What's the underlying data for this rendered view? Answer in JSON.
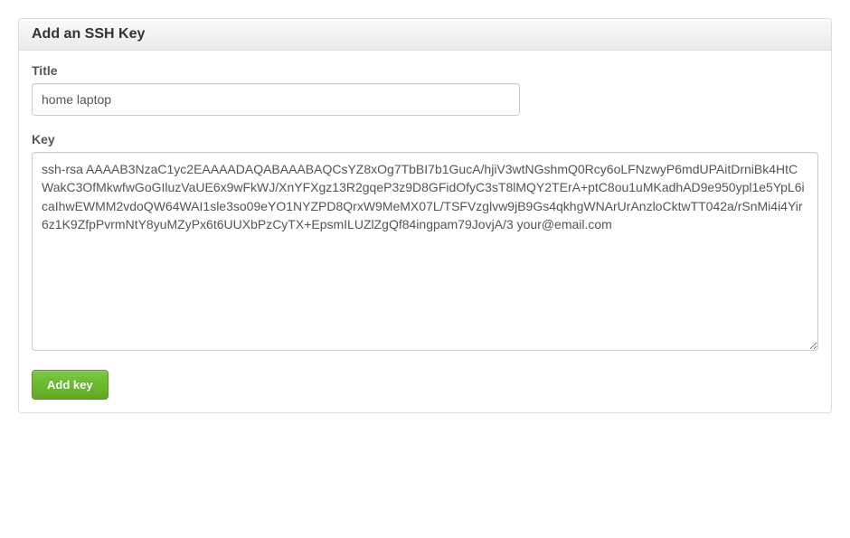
{
  "panel": {
    "title": "Add an SSH Key"
  },
  "form": {
    "title_label": "Title",
    "title_value": "home laptop",
    "key_label": "Key",
    "key_value": "ssh-rsa AAAAB3NzaC1yc2EAAAADAQABAAABAQCsYZ8xOg7TbBI7b1GucA/hjiV3wtNGshmQ0Rcy6oLFNzwyP6mdUPAitDrniBk4HtCWakC3OfMkwfwGoGIluzVaUE6x9wFkWJ/XnYFXgz13R2gqeP3z9D8GFidOfyC3sT8lMQY2TErA+ptC8ou1uMKadhAD9e950ypl1e5YpL6icaIhwEWMM2vdoQW64WAI1sle3so09eYO1NYZPD8QrxW9MeMX07L/TSFVzglvw9jB9Gs4qkhgWNArUrAnzloCktwTT042a/rSnMi4i4Yir6z1K9ZfpPvrmNtY8yuMZyPx6t6UUXbPzCyTX+EpsmILUZlZgQf84ingpam79JovjA/3 your@email.com",
    "submit_label": "Add key"
  }
}
